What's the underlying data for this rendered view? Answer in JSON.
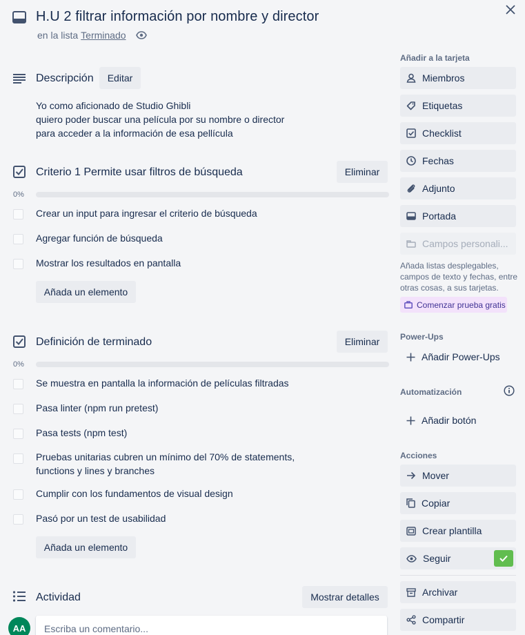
{
  "header": {
    "title": "H.U 2 filtrar información por nombre y director",
    "list_prefix": "en la lista",
    "list_name": "Terminado"
  },
  "description": {
    "heading": "Descripción",
    "edit_label": "Editar",
    "lines": [
      "Yo como aficionado de Studio Ghibli",
      "quiero poder buscar una película por su nombre o director",
      "para acceder a la información de esa pellícula"
    ]
  },
  "checklists": [
    {
      "title": "Criterio 1 Permite usar filtros de búsqueda",
      "delete_label": "Eliminar",
      "progress": "0%",
      "progress_value": 0,
      "items": [
        "Crear un input para ingresar el criterio de búsqueda",
        "Agregar función de búsqueda",
        "Mostrar los resultados en pantalla"
      ],
      "add_label": "Añada un elemento"
    },
    {
      "title": "Definición de terminado",
      "delete_label": "Eliminar",
      "progress": "0%",
      "progress_value": 0,
      "items": [
        "Se muestra en pantalla la información de películas filtradas",
        "Pasa linter (npm run pretest)",
        "Pasa tests (npm test)",
        "Pruebas unitarias cubren un mínimo del 70% de statements,",
        "functions y lines y branches",
        "Cumplir con los fundamentos de visual design",
        "Pasó por un test de usabilidad"
      ],
      "add_label": "Añada un elemento"
    }
  ],
  "activity": {
    "heading": "Actividad",
    "details_label": "Mostrar detalles",
    "avatar_initials": "AA",
    "comment_placeholder": "Escriba un comentario..."
  },
  "sidebar": {
    "add_heading": "Añadir a la tarjeta",
    "add_items": [
      "Miembros",
      "Etiquetas",
      "Checklist",
      "Fechas",
      "Adjunto",
      "Portada",
      "Campos personali..."
    ],
    "help_text": "Añada listas desplegables, campos de texto y fechas, entre otras cosas, a sus tarjetas.",
    "trial_label": "Comenzar prueba gratis",
    "powerups_heading": "Power-Ups",
    "powerups_add": "Añadir Power-Ups",
    "automation_heading": "Automatización",
    "automation_add": "Añadir botón",
    "actions_heading": "Acciones",
    "actions": [
      "Mover",
      "Copiar",
      "Crear plantilla",
      "Seguir",
      "Archivar",
      "Compartir"
    ],
    "follow_checked": true
  },
  "colors": {
    "background": "#f4f5f7",
    "button": "#eaecf0",
    "text": "#172b4d",
    "muted": "#5e6c84",
    "follow_check": "#61bd4f",
    "trial_bg": "#f3e2fb",
    "avatar": "#00875a"
  }
}
